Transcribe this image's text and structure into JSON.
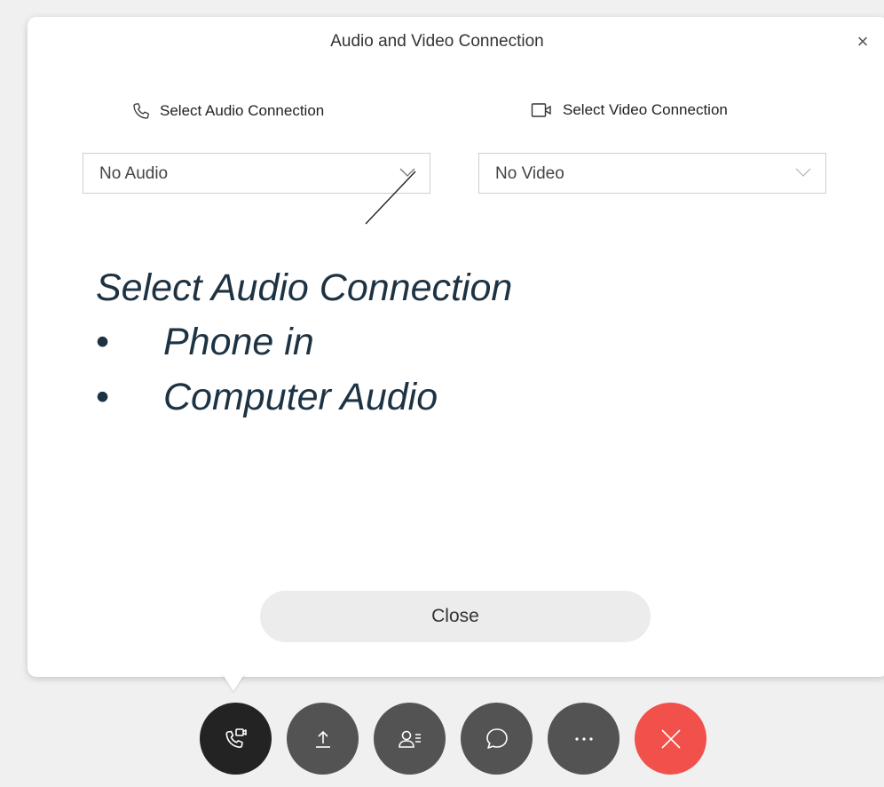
{
  "dialog": {
    "title": "Audio and Video Connection",
    "close_icon": "×"
  },
  "audio": {
    "label": "Select Audio Connection",
    "icon": "phone-icon",
    "selected": "No Audio"
  },
  "video": {
    "label": "Select Video Connection",
    "icon": "video-camera-icon",
    "selected": "No Video"
  },
  "annotation": {
    "heading": "Select Audio Connection",
    "items": [
      "Phone in",
      "Computer Audio"
    ],
    "bullet": "•"
  },
  "close_button": {
    "label": "Close"
  },
  "toolbar": {
    "buttons": [
      {
        "icon": "audio-video-connection-icon",
        "state": "active"
      },
      {
        "icon": "share-icon"
      },
      {
        "icon": "participants-icon"
      },
      {
        "icon": "chat-icon"
      },
      {
        "icon": "more-icon"
      },
      {
        "icon": "end-meeting-icon",
        "color": "#f1514a"
      }
    ]
  },
  "colors": {
    "annotation_text": "#1d3242",
    "end_button": "#f1514a",
    "active_button": "#232323",
    "toolbar_button": "#535353"
  }
}
